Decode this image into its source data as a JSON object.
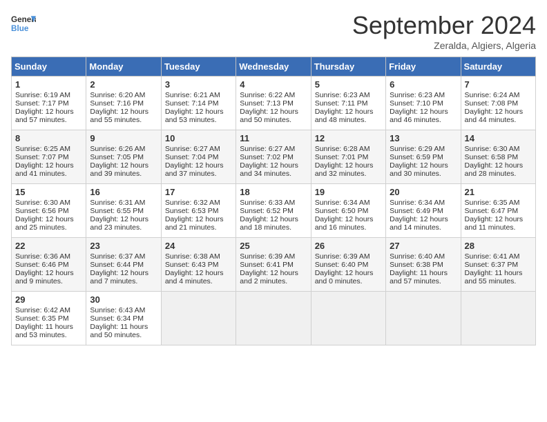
{
  "header": {
    "logo_line1": "General",
    "logo_line2": "Blue",
    "month": "September 2024",
    "location": "Zeralda, Algiers, Algeria"
  },
  "days_of_week": [
    "Sunday",
    "Monday",
    "Tuesday",
    "Wednesday",
    "Thursday",
    "Friday",
    "Saturday"
  ],
  "weeks": [
    [
      {
        "day": "1",
        "lines": [
          "Sunrise: 6:19 AM",
          "Sunset: 7:17 PM",
          "Daylight: 12 hours",
          "and 57 minutes."
        ]
      },
      {
        "day": "2",
        "lines": [
          "Sunrise: 6:20 AM",
          "Sunset: 7:16 PM",
          "Daylight: 12 hours",
          "and 55 minutes."
        ]
      },
      {
        "day": "3",
        "lines": [
          "Sunrise: 6:21 AM",
          "Sunset: 7:14 PM",
          "Daylight: 12 hours",
          "and 53 minutes."
        ]
      },
      {
        "day": "4",
        "lines": [
          "Sunrise: 6:22 AM",
          "Sunset: 7:13 PM",
          "Daylight: 12 hours",
          "and 50 minutes."
        ]
      },
      {
        "day": "5",
        "lines": [
          "Sunrise: 6:23 AM",
          "Sunset: 7:11 PM",
          "Daylight: 12 hours",
          "and 48 minutes."
        ]
      },
      {
        "day": "6",
        "lines": [
          "Sunrise: 6:23 AM",
          "Sunset: 7:10 PM",
          "Daylight: 12 hours",
          "and 46 minutes."
        ]
      },
      {
        "day": "7",
        "lines": [
          "Sunrise: 6:24 AM",
          "Sunset: 7:08 PM",
          "Daylight: 12 hours",
          "and 44 minutes."
        ]
      }
    ],
    [
      {
        "day": "8",
        "lines": [
          "Sunrise: 6:25 AM",
          "Sunset: 7:07 PM",
          "Daylight: 12 hours",
          "and 41 minutes."
        ]
      },
      {
        "day": "9",
        "lines": [
          "Sunrise: 6:26 AM",
          "Sunset: 7:05 PM",
          "Daylight: 12 hours",
          "and 39 minutes."
        ]
      },
      {
        "day": "10",
        "lines": [
          "Sunrise: 6:27 AM",
          "Sunset: 7:04 PM",
          "Daylight: 12 hours",
          "and 37 minutes."
        ]
      },
      {
        "day": "11",
        "lines": [
          "Sunrise: 6:27 AM",
          "Sunset: 7:02 PM",
          "Daylight: 12 hours",
          "and 34 minutes."
        ]
      },
      {
        "day": "12",
        "lines": [
          "Sunrise: 6:28 AM",
          "Sunset: 7:01 PM",
          "Daylight: 12 hours",
          "and 32 minutes."
        ]
      },
      {
        "day": "13",
        "lines": [
          "Sunrise: 6:29 AM",
          "Sunset: 6:59 PM",
          "Daylight: 12 hours",
          "and 30 minutes."
        ]
      },
      {
        "day": "14",
        "lines": [
          "Sunrise: 6:30 AM",
          "Sunset: 6:58 PM",
          "Daylight: 12 hours",
          "and 28 minutes."
        ]
      }
    ],
    [
      {
        "day": "15",
        "lines": [
          "Sunrise: 6:30 AM",
          "Sunset: 6:56 PM",
          "Daylight: 12 hours",
          "and 25 minutes."
        ]
      },
      {
        "day": "16",
        "lines": [
          "Sunrise: 6:31 AM",
          "Sunset: 6:55 PM",
          "Daylight: 12 hours",
          "and 23 minutes."
        ]
      },
      {
        "day": "17",
        "lines": [
          "Sunrise: 6:32 AM",
          "Sunset: 6:53 PM",
          "Daylight: 12 hours",
          "and 21 minutes."
        ]
      },
      {
        "day": "18",
        "lines": [
          "Sunrise: 6:33 AM",
          "Sunset: 6:52 PM",
          "Daylight: 12 hours",
          "and 18 minutes."
        ]
      },
      {
        "day": "19",
        "lines": [
          "Sunrise: 6:34 AM",
          "Sunset: 6:50 PM",
          "Daylight: 12 hours",
          "and 16 minutes."
        ]
      },
      {
        "day": "20",
        "lines": [
          "Sunrise: 6:34 AM",
          "Sunset: 6:49 PM",
          "Daylight: 12 hours",
          "and 14 minutes."
        ]
      },
      {
        "day": "21",
        "lines": [
          "Sunrise: 6:35 AM",
          "Sunset: 6:47 PM",
          "Daylight: 12 hours",
          "and 11 minutes."
        ]
      }
    ],
    [
      {
        "day": "22",
        "lines": [
          "Sunrise: 6:36 AM",
          "Sunset: 6:46 PM",
          "Daylight: 12 hours",
          "and 9 minutes."
        ]
      },
      {
        "day": "23",
        "lines": [
          "Sunrise: 6:37 AM",
          "Sunset: 6:44 PM",
          "Daylight: 12 hours",
          "and 7 minutes."
        ]
      },
      {
        "day": "24",
        "lines": [
          "Sunrise: 6:38 AM",
          "Sunset: 6:43 PM",
          "Daylight: 12 hours",
          "and 4 minutes."
        ]
      },
      {
        "day": "25",
        "lines": [
          "Sunrise: 6:39 AM",
          "Sunset: 6:41 PM",
          "Daylight: 12 hours",
          "and 2 minutes."
        ]
      },
      {
        "day": "26",
        "lines": [
          "Sunrise: 6:39 AM",
          "Sunset: 6:40 PM",
          "Daylight: 12 hours",
          "and 0 minutes."
        ]
      },
      {
        "day": "27",
        "lines": [
          "Sunrise: 6:40 AM",
          "Sunset: 6:38 PM",
          "Daylight: 11 hours",
          "and 57 minutes."
        ]
      },
      {
        "day": "28",
        "lines": [
          "Sunrise: 6:41 AM",
          "Sunset: 6:37 PM",
          "Daylight: 11 hours",
          "and 55 minutes."
        ]
      }
    ],
    [
      {
        "day": "29",
        "lines": [
          "Sunrise: 6:42 AM",
          "Sunset: 6:35 PM",
          "Daylight: 11 hours",
          "and 53 minutes."
        ]
      },
      {
        "day": "30",
        "lines": [
          "Sunrise: 6:43 AM",
          "Sunset: 6:34 PM",
          "Daylight: 11 hours",
          "and 50 minutes."
        ]
      },
      null,
      null,
      null,
      null,
      null
    ]
  ]
}
